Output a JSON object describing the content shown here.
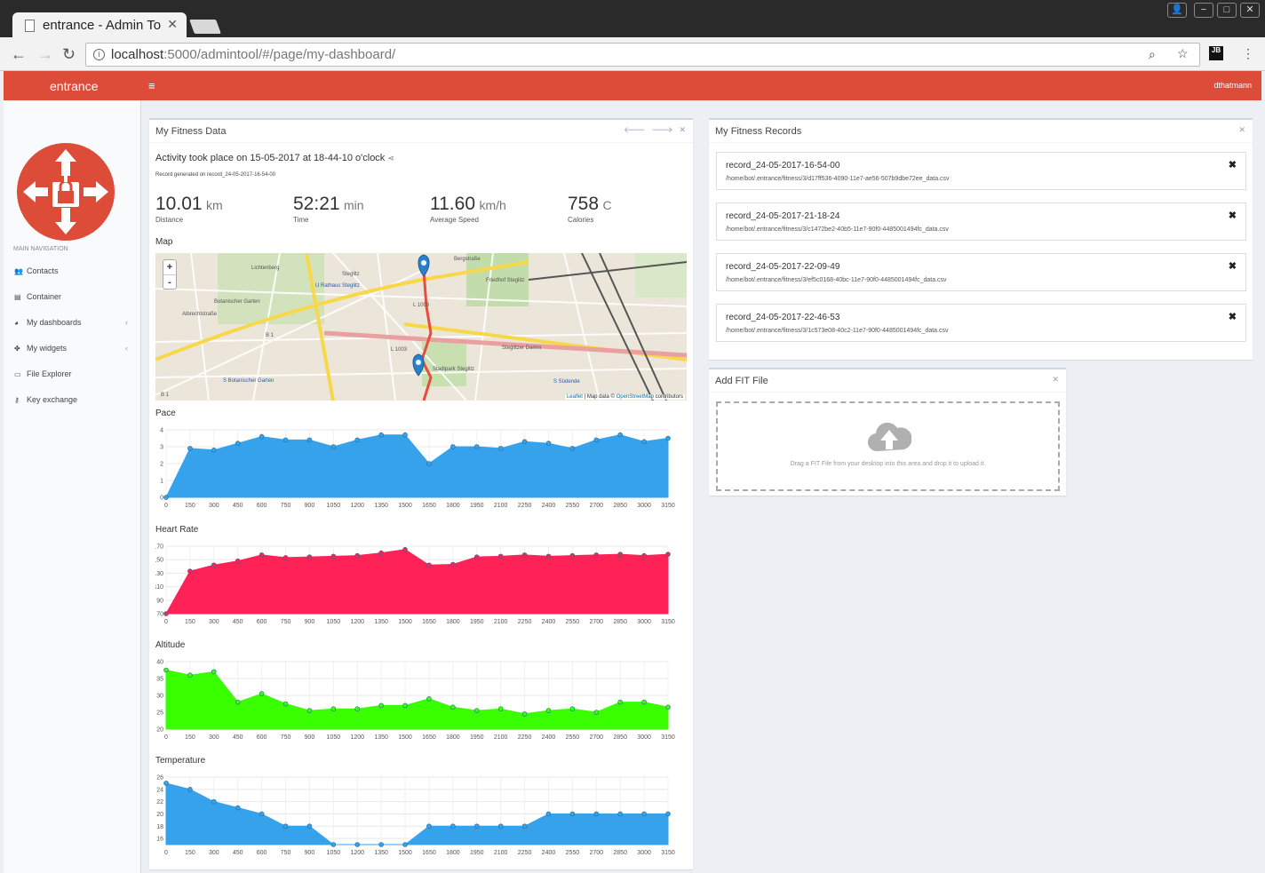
{
  "browser": {
    "tab_title": "entrance - Admin To",
    "url_host": "localhost",
    "url_path": ":5000/admintool/#/page/my-dashboard/",
    "ext_label": "JB"
  },
  "header": {
    "brand": "entrance",
    "menu_icon": "≡",
    "user": "dthatmann"
  },
  "sidebar": {
    "nav_heading": "MAIN NAVIGATION",
    "items": [
      {
        "label": "Contacts",
        "icon": "users-icon",
        "glyph": "👥"
      },
      {
        "label": "Container",
        "icon": "archive-icon",
        "glyph": "▤"
      },
      {
        "label": "My dashboards",
        "icon": "dashboard-icon",
        "glyph": "◕",
        "arrow": "‹"
      },
      {
        "label": "My widgets",
        "icon": "puzzle-icon",
        "glyph": "✤",
        "arrow": "‹"
      },
      {
        "label": "File Explorer",
        "icon": "file-icon",
        "glyph": "▭"
      },
      {
        "label": "Key exchange",
        "icon": "key-icon",
        "glyph": "⚷"
      }
    ]
  },
  "fitness": {
    "title": "My Fitness Data",
    "activity": "Activity took place on 15-05-2017 at 18-44-10 o'clock",
    "generated": "Record generated on record_24-05-2017-16-54-00",
    "stats": [
      {
        "value": "10.01",
        "unit": "km",
        "label": "Distance"
      },
      {
        "value": "52:21",
        "unit": "min",
        "label": "Time"
      },
      {
        "value": "11.60",
        "unit": "km/h",
        "label": "Average Speed"
      },
      {
        "value": "758",
        "unit": "C",
        "label": "Calories"
      }
    ],
    "map_label": "Map",
    "map_labels": [
      "Steglitz",
      "U Rathaus Steglitz",
      "L 1003",
      "L 1003",
      "B 1",
      "B 1",
      "S Botanischer Garten",
      "S Südende",
      "Lichtenberg",
      "Botanischer Garten",
      "Friedhof Steglitz",
      "Stadtpark Steglitz",
      "Steglitzer Damm",
      "Bergstraße",
      "Albrechtstraße"
    ],
    "zoom_in": "+",
    "zoom_out": "-",
    "attribution": {
      "leaflet": "Leaflet",
      "sep": " | Map data © ",
      "osm": "OpenStreetMap",
      "tail": " contributors"
    }
  },
  "chart_data": [
    {
      "type": "area",
      "title": "Pace",
      "color": "#36a2eb",
      "x": [
        0,
        150,
        300,
        450,
        600,
        750,
        900,
        1050,
        1200,
        1350,
        1500,
        1650,
        1800,
        1950,
        2100,
        2250,
        2400,
        2550,
        2700,
        2850,
        3000,
        3150
      ],
      "y": [
        0,
        2.9,
        2.8,
        3.2,
        3.6,
        3.4,
        3.4,
        3.0,
        3.4,
        3.7,
        3.7,
        2.0,
        3.0,
        3.0,
        2.9,
        3.3,
        3.2,
        2.9,
        3.4,
        3.7,
        3.3,
        3.5
      ],
      "yticks": [
        0,
        1,
        2,
        3,
        4
      ],
      "ylim": [
        0,
        4
      ]
    },
    {
      "type": "area",
      "title": "Heart Rate",
      "color": "#ff2256",
      "x": [
        0,
        150,
        300,
        450,
        600,
        750,
        900,
        1050,
        1200,
        1350,
        1500,
        1650,
        1800,
        1950,
        2100,
        2250,
        2400,
        2550,
        2700,
        2850,
        3000,
        3150
      ],
      "y": [
        70,
        133,
        142,
        148,
        157,
        153,
        154,
        155,
        156,
        160,
        165,
        142,
        143,
        154,
        155,
        157,
        155,
        156,
        157,
        158,
        156,
        158
      ],
      "yticks": [
        70,
        90,
        110,
        130,
        150,
        170
      ],
      "ylim": [
        70,
        170
      ]
    },
    {
      "type": "area",
      "title": "Altitude",
      "color": "#39ff00",
      "x": [
        0,
        150,
        300,
        450,
        600,
        750,
        900,
        1050,
        1200,
        1350,
        1500,
        1650,
        1800,
        1950,
        2100,
        2250,
        2400,
        2550,
        2700,
        2850,
        3000,
        3150
      ],
      "y": [
        37.5,
        36,
        37,
        28,
        30.5,
        27.5,
        25.5,
        26,
        26,
        27,
        27,
        29,
        26.5,
        25.5,
        26,
        24.5,
        25.5,
        26,
        25,
        28,
        28,
        26.5
      ],
      "yticks": [
        20,
        25,
        30,
        35,
        40
      ],
      "ylim": [
        20,
        40
      ]
    },
    {
      "type": "area",
      "title": "Temperature",
      "color": "#36a2eb",
      "x": [
        0,
        150,
        300,
        450,
        600,
        750,
        900,
        1050,
        1200,
        1350,
        1500,
        1650,
        1800,
        1950,
        2100,
        2250,
        2400,
        2550,
        2700,
        2850,
        3000,
        3150
      ],
      "y": [
        25,
        24,
        22,
        21,
        20,
        18,
        18,
        15,
        15,
        15,
        15,
        18,
        18,
        18,
        18,
        18,
        20,
        20,
        20,
        20,
        20,
        20
      ],
      "yticks": [
        16,
        18,
        20,
        22,
        24,
        26
      ],
      "ylim": [
        15,
        26
      ]
    }
  ],
  "records": {
    "title": "My Fitness Records",
    "items": [
      {
        "name": "record_24-05-2017-16-54-00",
        "path": "/home/bot/.entrance/fitness/3/d17ff536-4090-11e7-ae56-507b9dbe72ee_data.csv"
      },
      {
        "name": "record_24-05-2017-21-18-24",
        "path": "/home/bot/.entrance/fitness/3/c1472be2-40b5-11e7-90f0-4485001494fc_data.csv"
      },
      {
        "name": "record_24-05-2017-22-09-49",
        "path": "/home/bot/.entrance/fitness/3/ef5c0168-40bc-11e7-90f0-4485001494fc_data.csv"
      },
      {
        "name": "record_24-05-2017-22-46-53",
        "path": "/home/bot/.entrance/fitness/3/1c573e08-40c2-11e7-90f0-4485001494fc_data.csv"
      }
    ]
  },
  "upload": {
    "title": "Add FIT File",
    "hint": "Drag a FIT File from your desktop into this area and drop it to upload it."
  },
  "colors": {
    "brand": "#dd4b39",
    "pace": "#36a2eb",
    "heart": "#ff2256",
    "altitude": "#39ff00"
  }
}
